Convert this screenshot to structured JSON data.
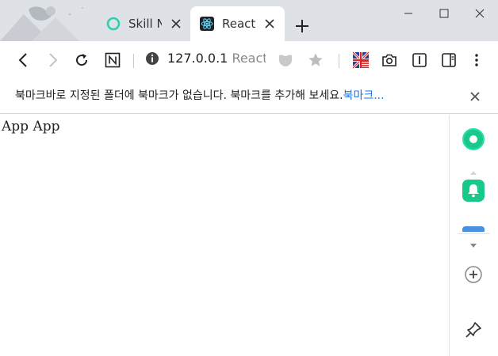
{
  "tabs": [
    {
      "title": "Skill N",
      "active": false,
      "icon": "circle-ring-icon",
      "color": "#2ecfb0"
    },
    {
      "title": "React",
      "active": true,
      "icon": "react-atom-icon",
      "color": "#61dafb"
    }
  ],
  "window_controls": [
    "minimize-icon",
    "maximize-icon",
    "close-icon"
  ],
  "address_bar": {
    "host": "127.0.0.1",
    "path": "React"
  },
  "bookmark_bar": {
    "message": "북마크바로 지정된 폴더에 북마크가 없습니다. 북마크를 추가해 보세요.",
    "link": "북마크..."
  },
  "page": {
    "text": "App App"
  },
  "side_panel": {
    "items": [
      "whale-green-icon",
      "bell-icon",
      "blue-app-icon",
      "add-icon",
      "pin-icon"
    ]
  },
  "colors": {
    "tabstrip": "#dee1e6",
    "link": "#1a73e8",
    "green": "#19c98a",
    "blue": "#4a90e2"
  }
}
